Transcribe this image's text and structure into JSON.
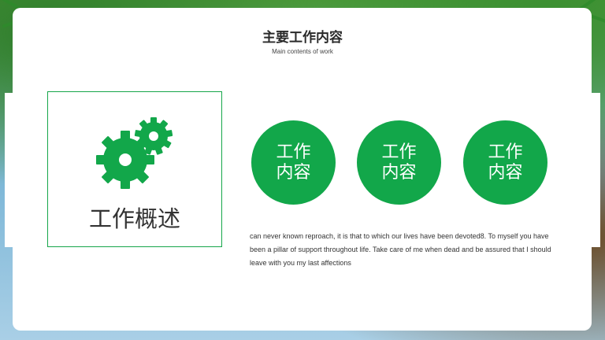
{
  "slide": {
    "title": "主要工作内容",
    "subtitle": "Main contents of work"
  },
  "overview": {
    "label": "工作概述",
    "icon": "gears-icon"
  },
  "circles": [
    {
      "label": "工作内容"
    },
    {
      "label": "工作内容"
    },
    {
      "label": "工作内容"
    }
  ],
  "description": "can never known reproach, it is that to which our lives have been devoted8. To myself you have been a pillar of support throughout life. Take care of me when dead and be assured that I should leave with you my last affections",
  "colors": {
    "accent": "#12a74a",
    "card": "#ffffff",
    "text": "#333333"
  }
}
